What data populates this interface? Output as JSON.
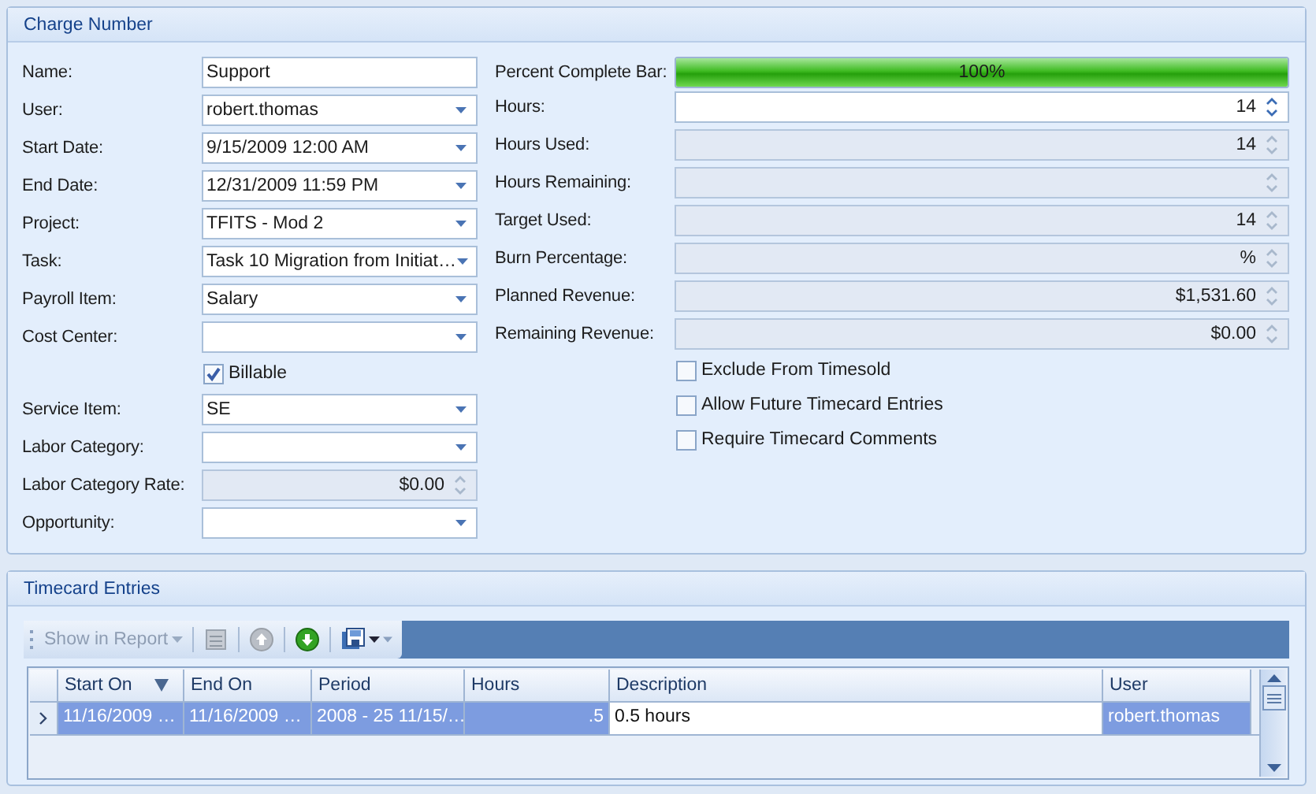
{
  "charge_number": {
    "title": "Charge Number",
    "left": [
      {
        "kind": "text",
        "label": "Name:",
        "value": "Support",
        "disabled": false
      },
      {
        "kind": "combo",
        "label": "User:",
        "value": "robert.thomas",
        "disabled": false
      },
      {
        "kind": "combo",
        "label": "Start Date:",
        "value": "9/15/2009 12:00 AM",
        "disabled": false
      },
      {
        "kind": "combo",
        "label": "End Date:",
        "value": "12/31/2009 11:59 PM",
        "disabled": false
      },
      {
        "kind": "combo",
        "label": "Project:",
        "value": "TFITS - Mod 2",
        "disabled": false
      },
      {
        "kind": "combo",
        "label": "Task:",
        "value": "Task 10 Migration from Initiat…",
        "disabled": false
      },
      {
        "kind": "combo",
        "label": "Payroll Item:",
        "value": "Salary",
        "disabled": false
      },
      {
        "kind": "combo",
        "label": "Cost Center:",
        "disabled": false
      },
      {
        "kind": "checkbox",
        "label": "Billable",
        "checked": true
      },
      {
        "kind": "combo",
        "label": "Service Item:",
        "value": "SE",
        "disabled": false
      },
      {
        "kind": "combo",
        "label": "Labor Category:",
        "disabled": false
      },
      {
        "kind": "spin",
        "label": "Labor Category Rate:",
        "value": "$0.00",
        "disabled": true
      },
      {
        "kind": "combo",
        "label": "Opportunity:",
        "disabled": false
      }
    ],
    "right": [
      {
        "kind": "progress",
        "label": "Percent Complete Bar:",
        "level": 1,
        "reading": "100%"
      },
      {
        "kind": "spin",
        "label": "Hours:",
        "value": "14",
        "disabled": false
      },
      {
        "kind": "spin",
        "label": "Hours Used:",
        "value": "14",
        "disabled": true
      },
      {
        "kind": "spin",
        "label": "Hours Remaining:",
        "disabled": true
      },
      {
        "kind": "spin",
        "label": "Target Used:",
        "value": "14",
        "disabled": true
      },
      {
        "kind": "spin",
        "label": "Burn Percentage:",
        "value": "%",
        "disabled": true
      },
      {
        "kind": "spin",
        "label": "Planned Revenue:",
        "value": "$1,531.60",
        "disabled": true
      },
      {
        "kind": "spin",
        "label": "Remaining Revenue:",
        "value": "$0.00",
        "disabled": true
      },
      {
        "kind": "checkbox",
        "label": "Exclude From Timesold",
        "checked": false
      },
      {
        "kind": "checkbox",
        "label": "Allow Future Timecard Entries",
        "checked": false
      },
      {
        "kind": "checkbox",
        "label": "Require Timecard Comments",
        "checked": false
      }
    ]
  },
  "timecard_entries": {
    "title": "Timecard Entries",
    "toolbar": [
      {
        "kind": "menu",
        "label": "Show in Report",
        "disabled": true
      },
      {
        "kind": "report",
        "disabled": true
      },
      {
        "kind": "up",
        "disabled": true
      },
      {
        "kind": "down",
        "disabled": false
      },
      {
        "kind": "export",
        "disabled": false
      }
    ],
    "table": {
      "columns": [
        {
          "label": "Start On",
          "sorted": true
        },
        {
          "label": "End On",
          "sorted": false
        },
        {
          "label": "Period",
          "sorted": false
        },
        {
          "label": "Hours",
          "sorted": false
        },
        {
          "label": "Description",
          "sorted": false
        },
        {
          "label": "User",
          "sorted": false
        }
      ],
      "rows": [
        {
          "current": true,
          "selected": true,
          "cells": [
            {
              "text": "11/16/2009 …",
              "focused": false
            },
            {
              "text": "11/16/2009 …",
              "focused": false
            },
            {
              "text": "2008 - 25 11/15/…",
              "focused": false
            },
            {
              "text": ".5",
              "focused": false
            },
            {
              "text": "0.5 hours",
              "focused": true
            },
            {
              "text": "robert.thomas",
              "focused": false
            }
          ]
        }
      ]
    }
  }
}
